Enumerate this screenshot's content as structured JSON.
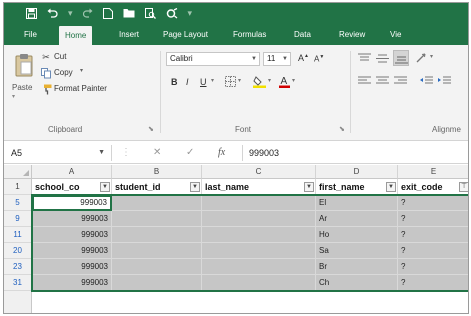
{
  "quick_access": {
    "save_icon": "save-icon",
    "undo_icon": "undo-icon",
    "redo_icon": "redo-icon",
    "new_icon": "new-file-icon",
    "open_icon": "open-folder-icon",
    "preview_icon": "print-preview-icon",
    "customize_icon": "customize-icon"
  },
  "tabs": [
    {
      "label": "File"
    },
    {
      "label": "Home"
    },
    {
      "label": "Insert"
    },
    {
      "label": "Page Layout"
    },
    {
      "label": "Formulas"
    },
    {
      "label": "Data"
    },
    {
      "label": "Review"
    },
    {
      "label": "Vie"
    }
  ],
  "active_tab": "Home",
  "ribbon": {
    "clipboard": {
      "paste": "Paste",
      "cut": "Cut",
      "copy": "Copy",
      "format_painter": "Format Painter",
      "group_label": "Clipboard"
    },
    "font": {
      "name": "Calibri",
      "size": "11",
      "bold": "B",
      "italic": "I",
      "underline": "U",
      "group_label": "Font"
    },
    "alignment": {
      "group_label": "Alignme"
    }
  },
  "formula_bar": {
    "name_box": "A5",
    "fx": "fx",
    "value": "999003"
  },
  "columns": [
    "A",
    "B",
    "C",
    "D",
    "E"
  ],
  "header_row": {
    "row_num": "1",
    "cells": [
      "school_co",
      "student_id",
      "last_name",
      "first_name",
      "exit_code"
    ]
  },
  "rows": [
    {
      "row_num": "5",
      "school": "999003",
      "first_name": "El",
      "exit_code": "?"
    },
    {
      "row_num": "9",
      "school": "999003",
      "first_name": "Ar",
      "exit_code": "?"
    },
    {
      "row_num": "11",
      "school": "999003",
      "first_name": "Ho",
      "exit_code": "?"
    },
    {
      "row_num": "20",
      "school": "999003",
      "first_name": "Sa",
      "exit_code": "?"
    },
    {
      "row_num": "23",
      "school": "999003",
      "first_name": "Br",
      "exit_code": "?"
    },
    {
      "row_num": "31",
      "school": "999003",
      "first_name": "Ch",
      "exit_code": "?"
    }
  ],
  "colors": {
    "brand": "#217346",
    "selection": "#c6c6c6",
    "filtered_row": "#1f5fbf"
  }
}
